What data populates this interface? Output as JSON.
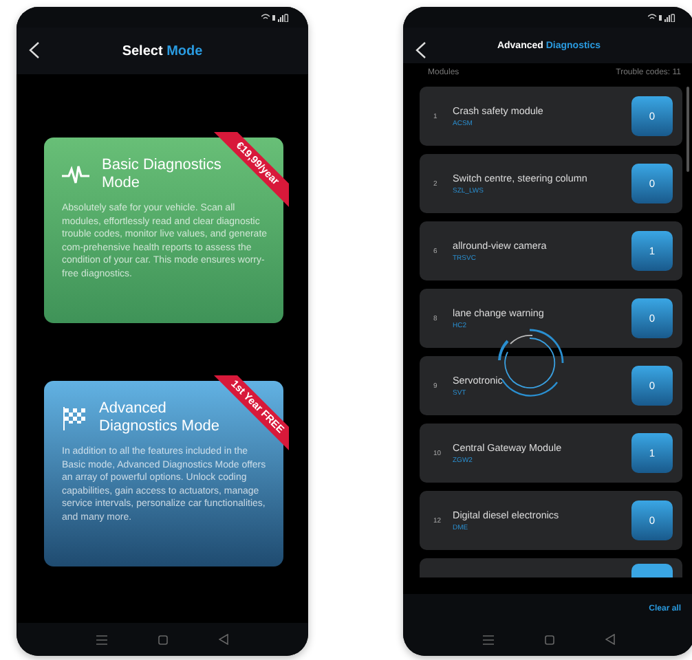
{
  "mode_screen": {
    "title": "Select",
    "title_accent": "Mode",
    "modes": [
      {
        "kind": "basic",
        "title": "Basic Diagnostics Mode",
        "ribbon": "€19,99/year",
        "description": "Absolutely safe for your vehicle. Scan all modules, effortlessly read and clear diagnostic trouble codes, monitor live values, and generate com-prehensive health reports to assess the condition of your car. This mode ensures worry-free diagnostics."
      },
      {
        "kind": "advanced",
        "title": "Advanced Diagnostics Mode",
        "ribbon": "1st Year FREE",
        "description": "In addition to all the features included in the Basic mode, Advanced Diagnostics Mode offers an array of powerful options. Unlock coding capabilities, gain access to actuators, manage service intervals, personalize car functionalities, and many more."
      }
    ]
  },
  "diagnostics_screen": {
    "title": "Advanced",
    "title_accent": "Diagnostics",
    "modules_label": "Modules",
    "trouble_codes": "Trouble codes: 11",
    "modules": [
      {
        "number": "1",
        "name": "Crash safety module",
        "code": "ACSM",
        "count": "0"
      },
      {
        "number": "2",
        "name": "Switch centre, steering column",
        "code": "SZL_LWS",
        "count": "0"
      },
      {
        "number": "6",
        "name": "allround-view camera",
        "code": "TRSVC",
        "count": "1"
      },
      {
        "number": "8",
        "name": "lane change warning",
        "code": "HC2",
        "count": "0"
      },
      {
        "number": "9",
        "name": "Servotronic",
        "code": "SVT",
        "count": "0"
      },
      {
        "number": "10",
        "name": "Central Gateway Module",
        "code": "ZGW2",
        "count": "1"
      },
      {
        "number": "12",
        "name": "Digital diesel electronics",
        "code": "DME",
        "count": "0"
      }
    ],
    "clear_button": "Clear all"
  }
}
